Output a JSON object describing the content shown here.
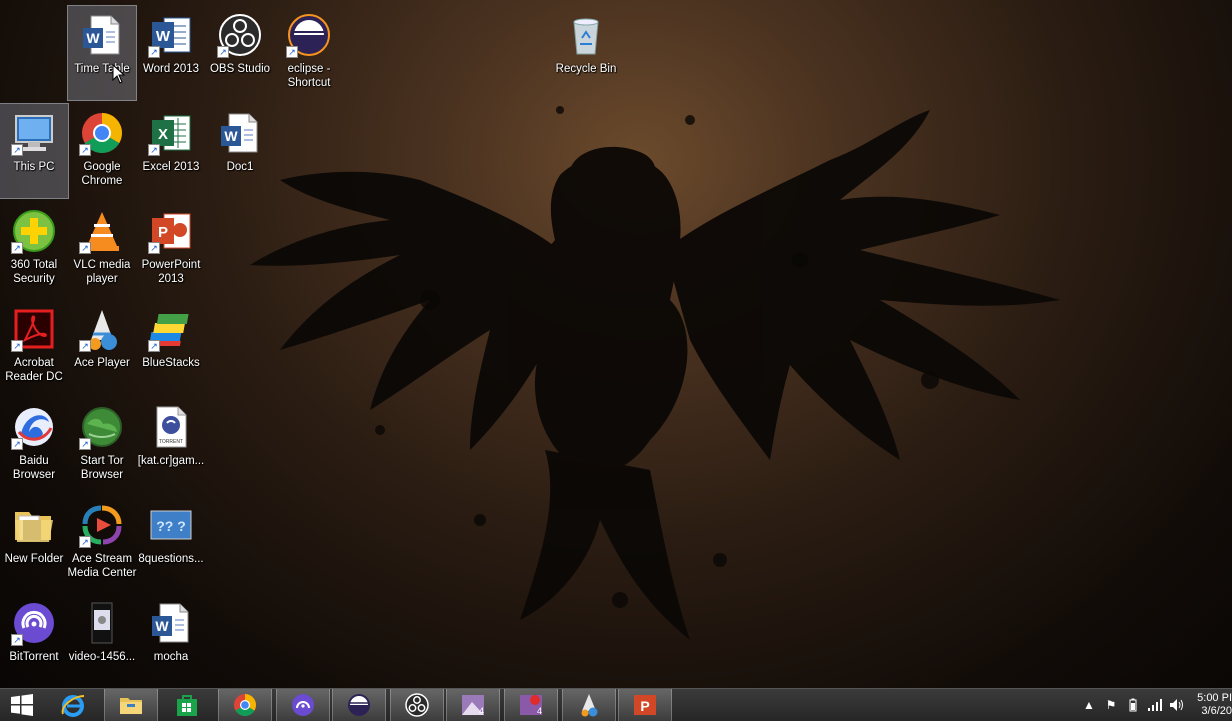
{
  "desktop": {
    "icons": [
      {
        "label": "Time Table",
        "icon": "word-document-icon"
      },
      {
        "label": "Word 2013",
        "icon": "word-icon"
      },
      {
        "label": "OBS Studio",
        "icon": "obs-icon"
      },
      {
        "label": "eclipse - Shortcut",
        "icon": "eclipse-icon"
      },
      {
        "label": "Recycle Bin",
        "icon": "recycle-bin-icon"
      },
      {
        "label": "This PC",
        "icon": "computer-icon"
      },
      {
        "label": "Google Chrome",
        "icon": "chrome-icon"
      },
      {
        "label": "Excel 2013",
        "icon": "excel-icon"
      },
      {
        "label": "Doc1",
        "icon": "word-document-icon"
      },
      {
        "label": "360 Total Security",
        "icon": "360-security-icon"
      },
      {
        "label": "VLC media player",
        "icon": "vlc-icon"
      },
      {
        "label": "PowerPoint 2013",
        "icon": "powerpoint-icon"
      },
      {
        "label": "Acrobat Reader DC",
        "icon": "acrobat-icon"
      },
      {
        "label": "Ace Player",
        "icon": "ace-player-icon"
      },
      {
        "label": "BlueStacks",
        "icon": "bluestacks-icon"
      },
      {
        "label": "Baidu Browser",
        "icon": "baidu-icon"
      },
      {
        "label": "Start Tor Browser",
        "icon": "tor-icon"
      },
      {
        "label": "[kat.cr]gam...",
        "icon": "torrent-file-icon"
      },
      {
        "label": "New Folder",
        "icon": "folder-icon"
      },
      {
        "label": "Ace Stream Media Center",
        "icon": "ace-stream-icon"
      },
      {
        "label": "8questions...",
        "icon": "image-file-icon"
      },
      {
        "label": "BitTorrent",
        "icon": "bittorrent-icon"
      },
      {
        "label": "video-1456...",
        "icon": "video-file-icon"
      },
      {
        "label": "mocha",
        "icon": "word-document-icon"
      }
    ]
  },
  "taskbar": {
    "items": [
      {
        "icon": "windows-start-icon"
      },
      {
        "icon": "internet-explorer-icon"
      },
      {
        "icon": "file-explorer-icon"
      },
      {
        "icon": "store-icon"
      },
      {
        "icon": "chrome-icon"
      },
      {
        "icon": "bittorrent-icon"
      },
      {
        "icon": "eclipse-icon"
      },
      {
        "icon": "obs-icon"
      },
      {
        "icon": "app-4-icon"
      },
      {
        "icon": "app-4-record-icon"
      },
      {
        "icon": "ace-player-icon"
      },
      {
        "icon": "powerpoint-icon"
      }
    ],
    "clock": {
      "time": "5:00 PI",
      "date": "3/6/20"
    },
    "tray": [
      "show-hidden-icons",
      "flag-icon",
      "battery-icon",
      "signal-icon",
      "volume-icon"
    ]
  }
}
